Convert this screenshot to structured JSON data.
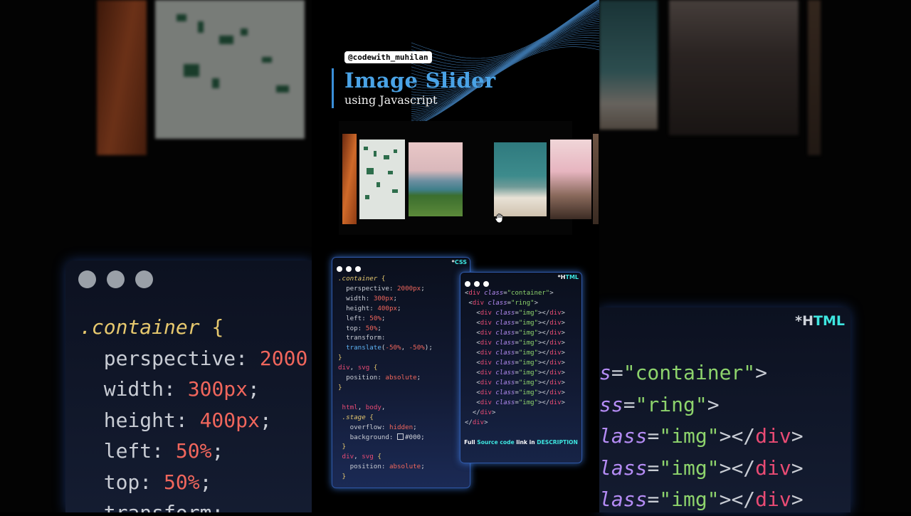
{
  "header": {
    "handle": "@codewith_muhilan",
    "title": "Image Slider",
    "subtitle": "using Javascript"
  },
  "slider": {
    "slides": [
      "orange-texture",
      "circuit-board",
      "seaside-cliff",
      "clouds",
      "record-player",
      "edge-slide"
    ],
    "cursor": "grab-hand-icon"
  },
  "css_card": {
    "tag_prefix": "*",
    "tag": "CSS",
    "lines": [
      ".container {",
      "  perspective: 2000px;",
      "  width: 300px;",
      "  height: 400px;",
      "  left: 50%;",
      "  top: 50%;",
      "  transform:",
      "  translate(-50%, -50%);",
      "}",
      "div, svg {",
      "  position: absolute;",
      "}",
      "",
      "html, body,",
      ".stage {",
      "  overflow: hidden;",
      "  background: #000;",
      "}",
      "div, svg {",
      "  position: absolute;",
      "}"
    ]
  },
  "html_card": {
    "tag_prefix": "*",
    "tag": "HTML",
    "lines": [
      "<div class=\"container\">",
      " <div class=\"ring\">",
      "   <div class=\"img\"></div>",
      "   <div class=\"img\"></div>",
      "   <div class=\"img\"></div>",
      "   <div class=\"img\"></div>",
      "   <div class=\"img\"></div>",
      "   <div class=\"img\"></div>",
      "   <div class=\"img\"></div>",
      "   <div class=\"img\"></div>",
      "   <div class=\"img\"></div>",
      "   <div class=\"img\"></div>",
      "  </div>",
      "</div>"
    ],
    "footer": {
      "part1": "Full ",
      "part2": "Source code",
      "part3": " link in ",
      "part4": "DESCRIPTION"
    }
  },
  "background": {
    "left_code": [
      ".container {",
      "  perspective: 2000",
      "  width: 300px;",
      "  height: 400px;",
      "  left: 50%;",
      "  top: 50%;",
      "  transform:"
    ],
    "right_tag": "*HTML",
    "right_code": [
      "s=\"container\">",
      "ss=\"ring\">",
      "lass=\"img\"></div>",
      "lass=\"img\"></div>",
      "lass=\"img\"></div>"
    ]
  },
  "colors": {
    "accent_blue": "#4aa3e6",
    "accent_cyan": "#3ee6e0",
    "card_glow": "#2f58a8"
  }
}
